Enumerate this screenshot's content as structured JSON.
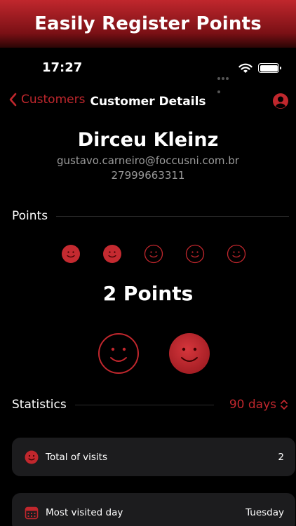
{
  "banner": {
    "title": "Easily Register Points"
  },
  "status_bar": {
    "time": "17:27"
  },
  "nav": {
    "back_label": "Customers",
    "title": "Customer Details"
  },
  "customer": {
    "name": "Dirceu Kleinz",
    "email": "gustavo.carneiro@foccusni.com.br",
    "phone": "27999663311"
  },
  "points": {
    "section_label": "Points",
    "filled": 2,
    "total": 5,
    "count_label": "2 Points"
  },
  "statistics": {
    "section_label": "Statistics",
    "range": "90 days",
    "rows": [
      {
        "icon": "smiley-icon",
        "label": "Total of visits",
        "value": "2"
      },
      {
        "icon": "calendar-icon",
        "label": "Most visited day",
        "value": "Tuesday"
      }
    ]
  },
  "colors": {
    "accent": "#c0272d",
    "background": "#000000",
    "card": "#1c1c1e"
  }
}
